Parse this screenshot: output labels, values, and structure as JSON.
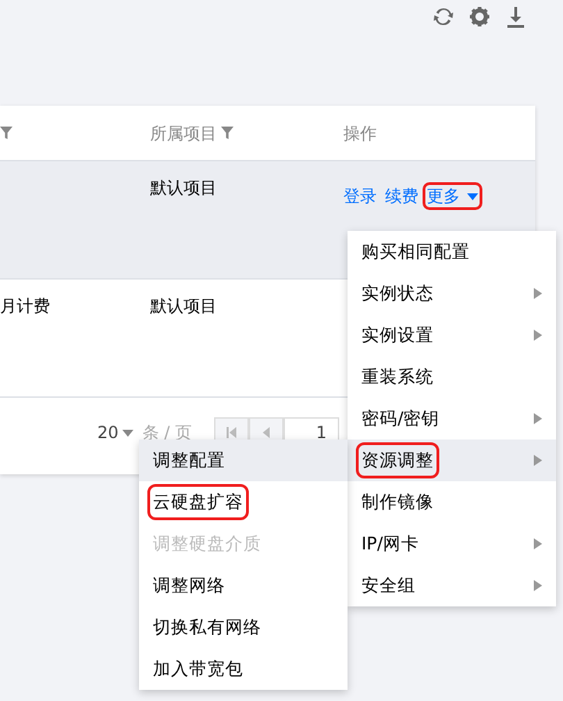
{
  "table": {
    "columns": [
      {
        "filter": true
      },
      {
        "label": "所属项目",
        "filter": true
      },
      {
        "label": "操作",
        "filter": false
      }
    ],
    "rows": [
      {
        "selected": true,
        "project": "默认项目",
        "actions": [
          {
            "label": "登录",
            "kind": "link"
          },
          {
            "label": "续费",
            "kind": "link"
          },
          {
            "label": "更多",
            "kind": "dropdown",
            "highlighted": true
          }
        ]
      },
      {
        "selected": false,
        "column_1": "月计费",
        "project": "默认项目",
        "actions": []
      }
    ]
  },
  "pagination": {
    "page_size": "20",
    "page_size_unit": "条 / 页",
    "page": "1"
  },
  "menu": [
    {
      "label": "购买相同配置",
      "submenu": false,
      "selected": false,
      "highlighted": false
    },
    {
      "label": "实例状态",
      "submenu": true,
      "selected": false,
      "highlighted": false
    },
    {
      "label": "实例设置",
      "submenu": true,
      "selected": false,
      "highlighted": false
    },
    {
      "label": "重装系统",
      "submenu": false,
      "selected": false,
      "highlighted": false
    },
    {
      "label": "密码/密钥",
      "submenu": true,
      "selected": false,
      "highlighted": false
    },
    {
      "label": "资源调整",
      "submenu": true,
      "selected": true,
      "highlighted": true
    },
    {
      "label": "制作镜像",
      "submenu": false,
      "selected": false,
      "highlighted": false
    },
    {
      "label": "IP/网卡",
      "submenu": true,
      "selected": false,
      "highlighted": false
    },
    {
      "label": "安全组",
      "submenu": true,
      "selected": false,
      "highlighted": false
    }
  ],
  "submenu": [
    {
      "label": "调整配置",
      "selected": true,
      "disabled": false,
      "highlighted": false
    },
    {
      "label": "云硬盘扩容",
      "selected": false,
      "disabled": false,
      "highlighted": true
    },
    {
      "label": "调整硬盘介质",
      "selected": false,
      "disabled": true,
      "highlighted": false
    },
    {
      "label": "调整网络",
      "selected": false,
      "disabled": false,
      "highlighted": false
    },
    {
      "label": "切换私有网络",
      "selected": false,
      "disabled": false,
      "highlighted": false
    },
    {
      "label": "加入带宽包",
      "selected": false,
      "disabled": false,
      "highlighted": false
    }
  ]
}
